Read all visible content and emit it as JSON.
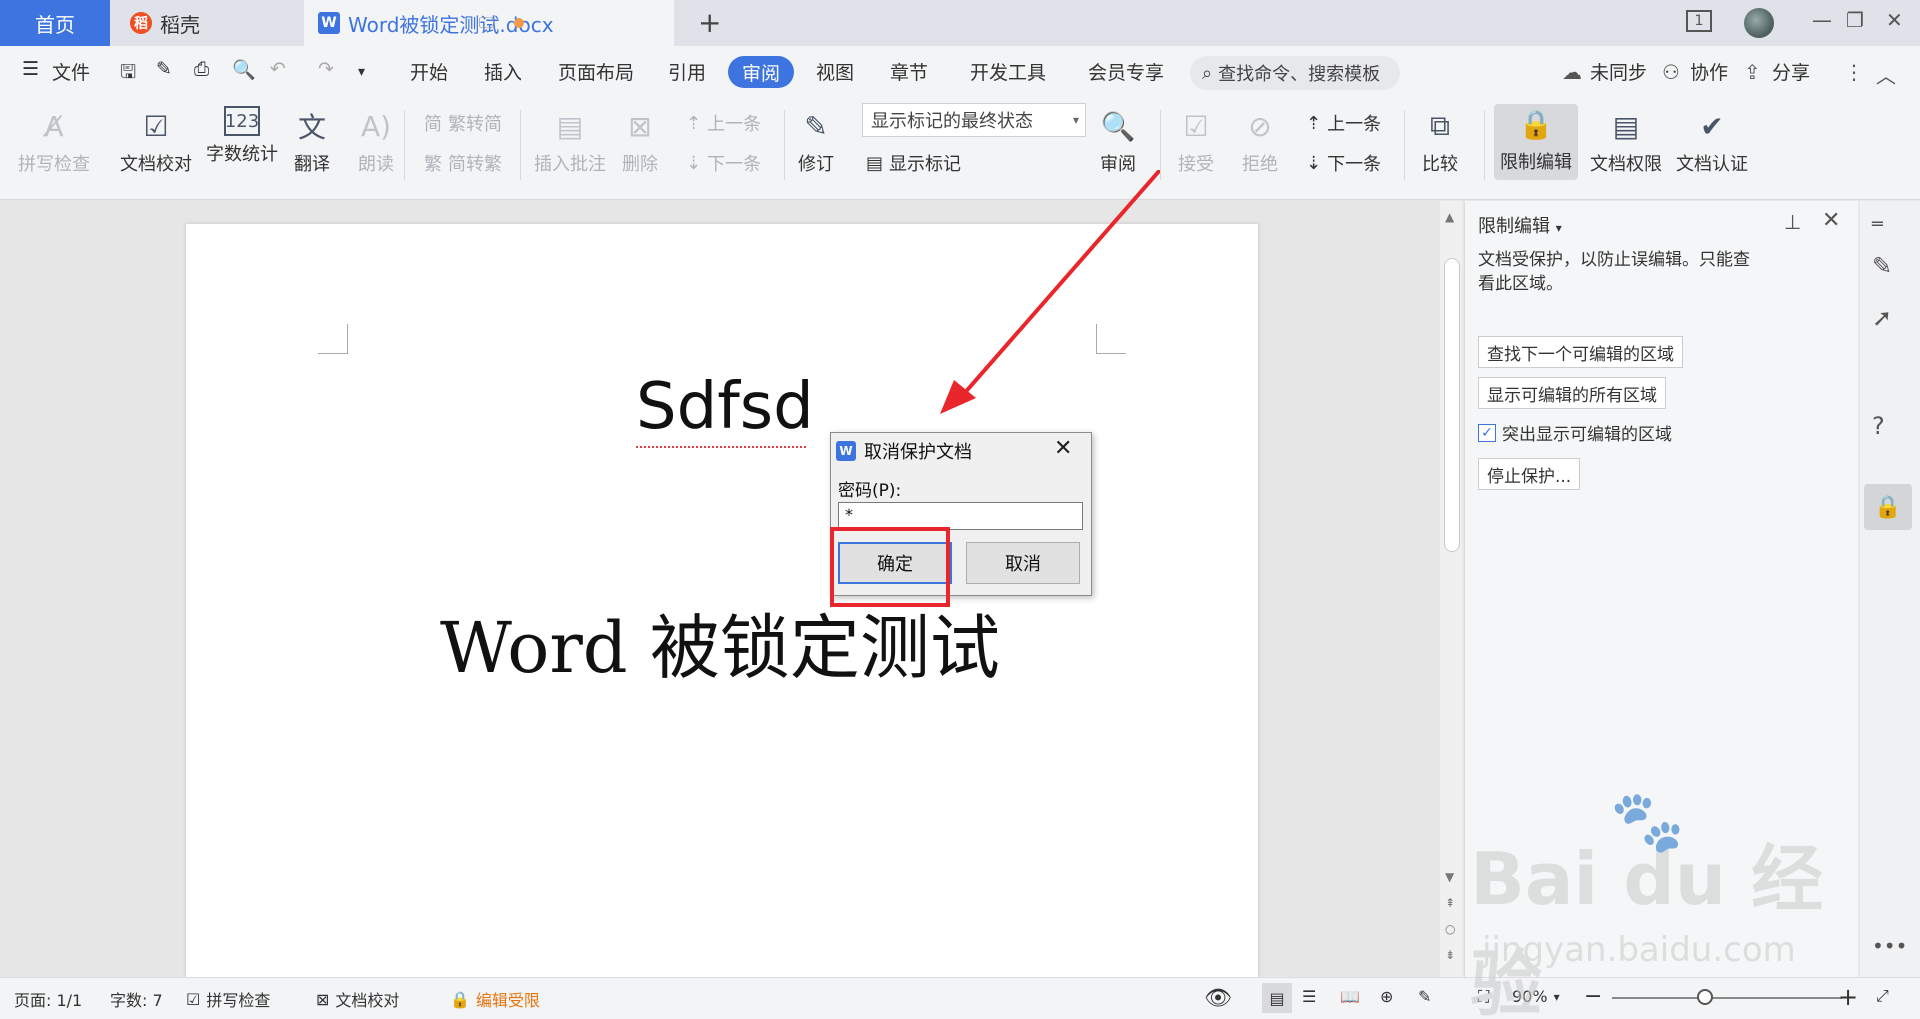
{
  "tabs": {
    "home": "首页",
    "daoke": "稻壳",
    "doc": "Word被锁定测试.docx",
    "new_tab": "+",
    "page_count_badge": "1"
  },
  "menu": {
    "file": "文件",
    "items": [
      "开始",
      "插入",
      "页面布局",
      "引用",
      "审阅",
      "视图",
      "章节",
      "开发工具",
      "会员专享"
    ],
    "active": "审阅",
    "search_placeholder": "查找命令、搜索模板",
    "sync": "未同步",
    "collab": "协作",
    "share": "分享"
  },
  "ribbon": {
    "spellcheck": "拼写检查",
    "proofread": "文档校对",
    "wordcount": "字数统计",
    "translate": "翻译",
    "read_aloud": "朗读",
    "trad_to_simp": "繁转简",
    "simp_to_trad": "简转繁",
    "insert_comment": "插入批注",
    "delete": "删除",
    "prev_comment": "上一条",
    "next_comment": "下一条",
    "revise": "修订",
    "markup_state": "显示标记的最终状态",
    "show_markup": "显示标记",
    "review": "审阅",
    "accept": "接受",
    "reject": "拒绝",
    "prev_change": "上一条",
    "next_change": "下一条",
    "compare": "比较",
    "restrict_edit": "限制编辑",
    "doc_rights": "文档权限",
    "doc_cert": "文档认证"
  },
  "document": {
    "line1": "Sdfsd",
    "line2": "Word 被锁定测试"
  },
  "pane": {
    "title": "限制编辑",
    "desc": "文档受保护，以防止误编辑。只能查看此区域。",
    "find_next": "查找下一个可编辑的区域",
    "show_all": "显示可编辑的所有区域",
    "highlight": "突出显示可编辑的区域",
    "stop": "停止保护..."
  },
  "dialog": {
    "title": "取消保护文档",
    "password_label": "密码(P):",
    "password_value": "*",
    "ok": "确定",
    "cancel": "取消"
  },
  "status": {
    "page": "页面: 1/1",
    "words": "字数: 7",
    "spell": "拼写检查",
    "proof": "文档校对",
    "restricted": "编辑受限",
    "zoom": "90%"
  },
  "watermark": {
    "brand": "Bai du 经验",
    "url": "jingyan.baidu.com"
  },
  "colors": {
    "accent": "#3d74e0",
    "highlight_red": "#e8262b",
    "warning": "#e8740c"
  }
}
